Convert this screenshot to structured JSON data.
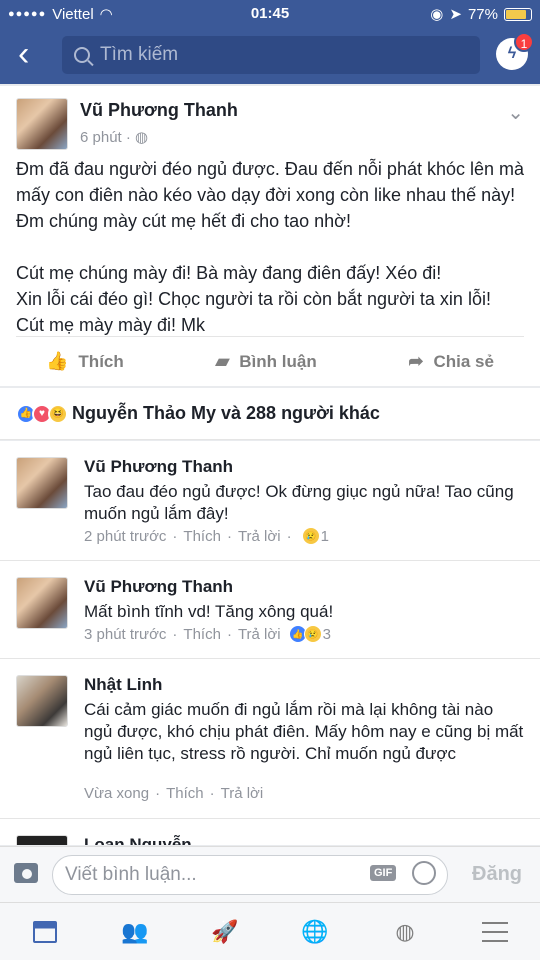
{
  "status": {
    "carrier": "Viettel",
    "time": "01:45",
    "battery": "77%",
    "signal_dots": "●●●●●"
  },
  "nav": {
    "search_placeholder": "Tìm kiếm",
    "messenger_badge": "1"
  },
  "post": {
    "author": "Vũ Phương Thanh",
    "time": "6 phút · ",
    "text": "Đm đã đau người đéo ngủ được. Đau đến nỗi phát khóc lên mà mấy con điên nào kéo vào dạy đời xong còn like nhau thế này! Đm chúng mày cút mẹ hết đi cho tao nhờ!\n\nCút mẹ chúng mày đi! Bà mày đang điên đấy! Xéo đi!\nXin lỗi cái đéo gì! Chọc người ta rồi còn bắt người ta xin lỗi!\nCút mẹ mày mày đi! Mk",
    "actions": {
      "like": "Thích",
      "comment": "Bình luận",
      "share": "Chia sẻ"
    }
  },
  "reactions_summary": "Nguyễn Thảo My và 288 người khác",
  "comments": [
    {
      "author": "Vũ Phương Thanh",
      "text": "Tao đau đéo ngủ được! Ok đừng giục ngủ nữa! Tao cũng muốn ngủ lắm đây!",
      "time": "2 phút trước",
      "like": "Thích",
      "reply": "Trả lời",
      "reaction_count": "1"
    },
    {
      "author": "Vũ Phương Thanh",
      "text": "Mất bình tĩnh vd! Tăng xông quá!",
      "time": "3 phút trước",
      "like": "Thích",
      "reply": "Trả lời",
      "reaction_count": "3"
    },
    {
      "author": "Nhật Linh",
      "text": "Cái cảm giác muốn đi ngủ lắm rồi mà lại không tài nào ngủ được, khó chịu phát điên. Mấy hôm nay e cũng bị mất ngủ liên tục, stress rồ người. Chỉ muốn ngủ được",
      "time": "Vừa xong",
      "like": "Thích",
      "reply": "Trả lời"
    },
    {
      "author": "Loan Nguyễn"
    }
  ],
  "composer": {
    "placeholder": "Viết bình luận...",
    "gif": "GIF",
    "send": "Đăng"
  }
}
